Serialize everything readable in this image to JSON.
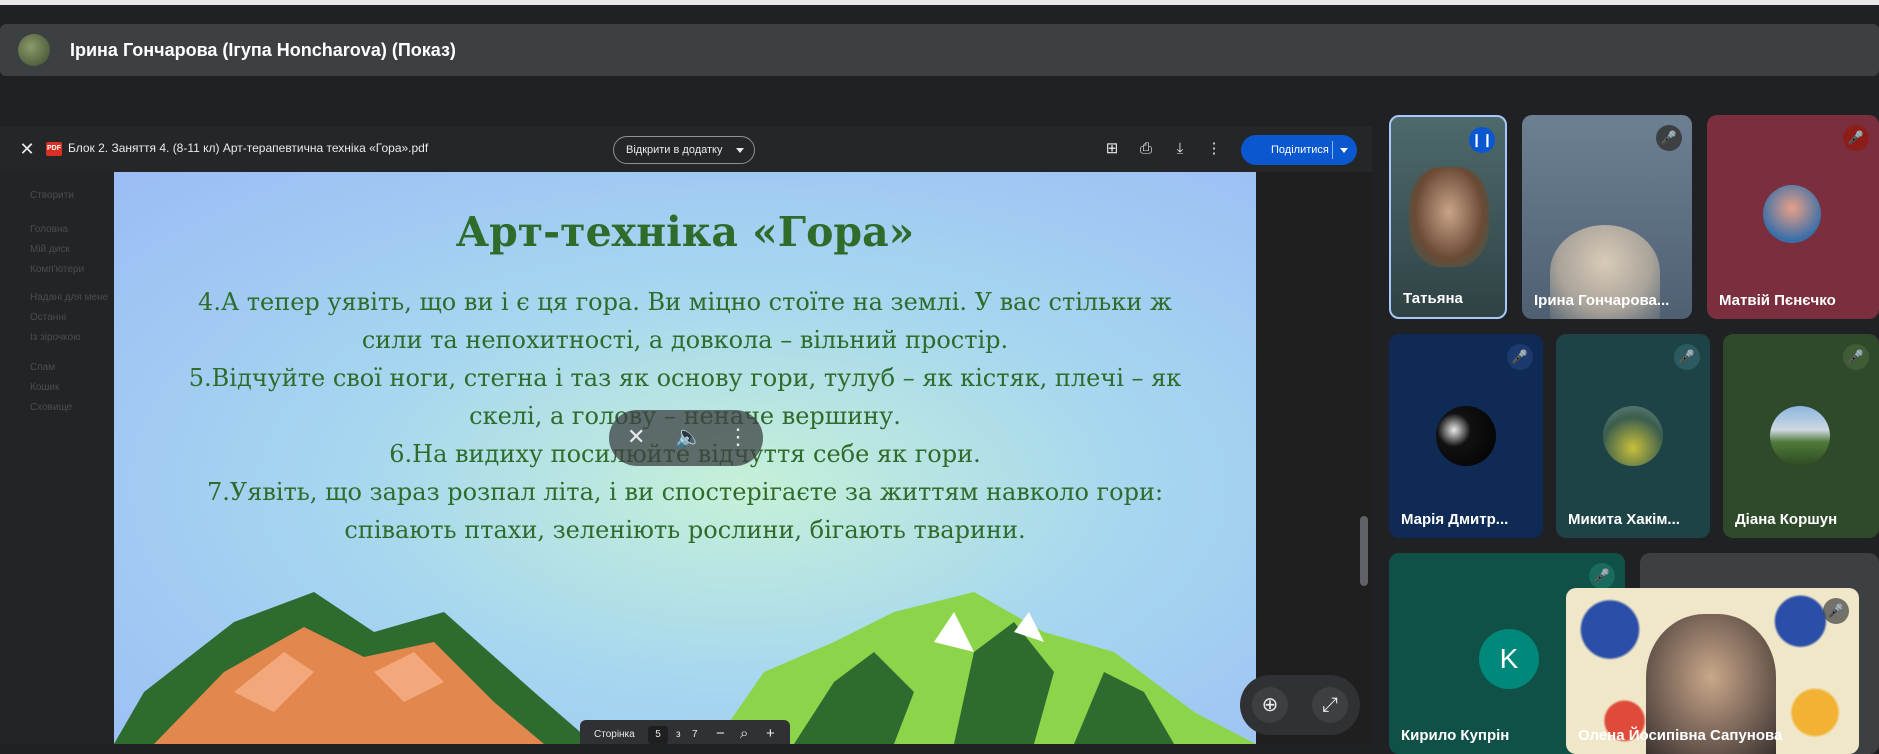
{
  "presenter_bar": {
    "title": "Ірина Гончарова (Ігупа Нoncharova) (Показ)"
  },
  "pdf_viewer": {
    "close_icon": "close-icon",
    "filename": "Блок 2. Заняття 4. (8-11 кл) Арт-терапевтична техніка «Гора».pdf",
    "file_badge": "PDF",
    "open_in_app_label": "Відкрити в додатку",
    "share_label": "Поділитися",
    "toolbar_icons": [
      "add-comment-icon",
      "print-icon",
      "download-icon",
      "more-vert-icon"
    ]
  },
  "sidebar_ghost": {
    "create_label": "Створити",
    "items": [
      "Головна",
      "Мій диск",
      "Комп'ютери",
      "Надані для мене",
      "Останні",
      "Із зірочкою",
      "Спам",
      "Кошик",
      "Сховище"
    ]
  },
  "slide": {
    "title": "Арт-техніка «Гора»",
    "lines": [
      "4.А тепер уявіть, що ви і є ця гора. Ви міцно стоїте на землі. У вас стільки ж",
      "сили та непохитності, а довкола – вільний простір.",
      "5.Відчуйте свої ноги, стегна і таз як основу гори, тулуб – як кістяк, плечі – як",
      "скелі, а голову – неначе вершину.",
      "6.На видиху посилюйте відчуття себе як гори.",
      "7.Уявіть, що зараз розпал літа, і ви спостерігаєте за життям навколо гори:",
      "співають птахи, зеленіють рослини, бігають тварини."
    ]
  },
  "page_control": {
    "label": "Сторінка",
    "current": "5",
    "of": "з",
    "total": "7"
  },
  "participants": [
    {
      "name": "Татьяна",
      "mic": "speaking"
    },
    {
      "name": "Ірина Гончарова...",
      "mic": "muted"
    },
    {
      "name": "Матвій Пєнєчко",
      "mic": "muted"
    },
    {
      "name": "Марія Дмитр...",
      "mic": "muted"
    },
    {
      "name": "Микита Хакім...",
      "mic": "muted"
    },
    {
      "name": "Діана Коршун",
      "mic": "muted"
    },
    {
      "name": "Кирило Купрін",
      "mic": "muted",
      "initial": "K"
    },
    {
      "name": "Олена Йосипівна Сапунова",
      "mic": "muted"
    }
  ],
  "colors": {
    "accent_blue": "#0b57d0",
    "slide_text": "#2f6b2a",
    "muted_badge": "#3c4043",
    "muted_badge_red": "#8c1d18"
  }
}
